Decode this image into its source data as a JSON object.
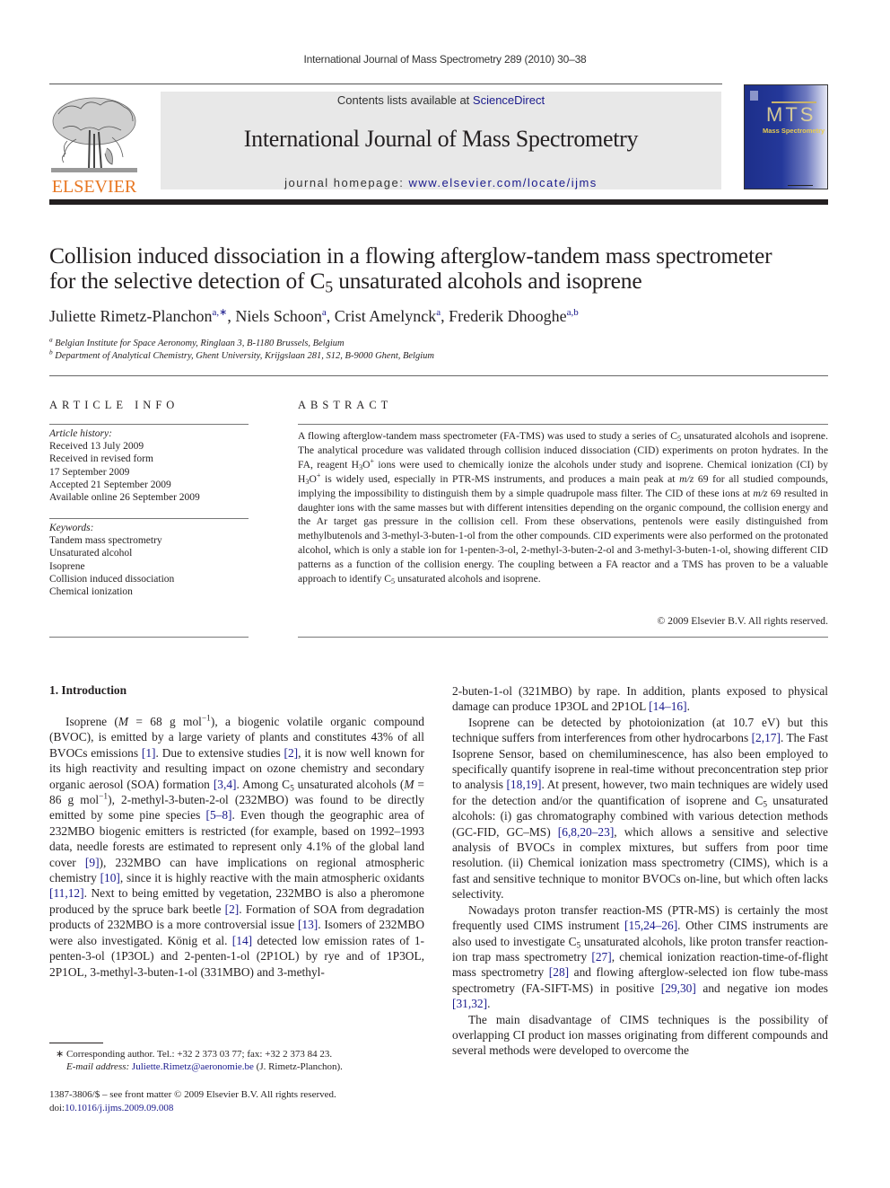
{
  "header": {
    "running_head": "International Journal of Mass Spectrometry 289 (2010) 30–38",
    "contents_prefix": "Contents lists available at ",
    "contents_link": "ScienceDirect",
    "journal_title": "International Journal of Mass Spectrometry",
    "homepage_prefix": "journal homepage: ",
    "homepage_link": "www.elsevier.com/locate/ijms",
    "publisher_logo_text": "ELSEVIER",
    "cover_label": "Mass Spectrometry",
    "cover_monogram": "MTS"
  },
  "colors": {
    "link": "#1a1a8c",
    "elsevier_orange": "#e87722",
    "cover_blue": "#1d2f8a",
    "masthead_gray": "#e8e8e8"
  },
  "article": {
    "title_line1": "Collision induced dissociation in a flowing afterglow-tandem mass spectrometer",
    "title_line2_a": "for the selective detection of C",
    "title_line2_sub": "5",
    "title_line2_b": " unsaturated alcohols and isoprene",
    "authors": [
      {
        "name": "Juliette Rimetz-Planchon",
        "aff": "a,∗"
      },
      {
        "name": "Niels Schoon",
        "aff": "a"
      },
      {
        "name": "Crist Amelynck",
        "aff": "a"
      },
      {
        "name": "Frederik Dhooghe",
        "aff": "a,b"
      }
    ],
    "affiliations": [
      {
        "mark": "a",
        "text": "Belgian Institute for Space Aeronomy, Ringlaan 3, B-1180 Brussels, Belgium"
      },
      {
        "mark": "b",
        "text": "Department of Analytical Chemistry, Ghent University, Krijgslaan 281, S12, B-9000 Ghent, Belgium"
      }
    ]
  },
  "article_info": {
    "heading": "ARTICLE INFO",
    "history_label": "Article history:",
    "history": [
      "Received 13 July 2009",
      "Received in revised form",
      "17 September 2009",
      "Accepted 21 September 2009",
      "Available online 26 September 2009"
    ],
    "keywords_label": "Keywords:",
    "keywords": [
      "Tandem mass spectrometry",
      "Unsaturated alcohol",
      "Isoprene",
      "Collision induced dissociation",
      "Chemical ionization"
    ]
  },
  "abstract": {
    "heading": "ABSTRACT",
    "text": [
      "A flowing afterglow-tandem mass spectrometer (FA-TMS) was used to study a series of C",
      "5",
      " unsaturated alcohols and isoprene. The analytical procedure was validated through collision induced dissociation (CID) experiments on proton hydrates. In the FA, reagent H",
      "3",
      "O",
      "+",
      " ions were used to chemically ionize the alcohols under study and isoprene. Chemical ionization (CI) by H",
      "3",
      "O",
      "+",
      " is widely used, especially in PTR-MS instruments, and produces a main peak at ",
      "m/z",
      " 69 for all studied compounds, implying the impossibility to distinguish them by a simple quadrupole mass filter. The CID of these ions at ",
      "m/z",
      " 69 resulted in daughter ions with the same masses but with different intensities depending on the organic compound, the collision energy and the Ar target gas pressure in the collision cell. From these observations, pentenols were easily distinguished from methylbutenols and 3-methyl-3-buten-1-ol from the other compounds. CID experiments were also performed on the protonated alcohol, which is only a stable ion for 1-penten-3-ol, 2-methyl-3-buten-2-ol and 3-methyl-3-buten-1-ol, showing different CID patterns as a function of the collision energy. The coupling between a FA reactor and a TMS has proven to be a valuable approach to identify C",
      "5",
      " unsaturated alcohols and isoprene."
    ],
    "copyright": "© 2009 Elsevier B.V. All rights reserved."
  },
  "body": {
    "section_heading": "1.  Introduction",
    "left_paragraph": [
      {
        "t": "Isoprene ("
      },
      {
        "i": "M"
      },
      {
        "t": " = 68 g mol"
      },
      {
        "sup": "−1"
      },
      {
        "t": "), a biogenic volatile organic compound (BVOC), is emitted by a large variety of plants and constitutes 43% of all BVOCs emissions "
      },
      {
        "c": "[1]"
      },
      {
        "t": ". Due to extensive studies "
      },
      {
        "c": "[2]"
      },
      {
        "t": ", it is now well known for its high reactivity and resulting impact on ozone chemistry and secondary organic aerosol (SOA) formation "
      },
      {
        "c": "[3,4]"
      },
      {
        "t": ". Among C"
      },
      {
        "sub": "5"
      },
      {
        "t": " unsaturated alcohols ("
      },
      {
        "i": "M"
      },
      {
        "t": " = 86 g mol"
      },
      {
        "sup": "−1"
      },
      {
        "t": "), 2-methyl-3-buten-2-ol (232MBO) was found to be directly emitted by some pine species "
      },
      {
        "c": "[5–8]"
      },
      {
        "t": ". Even though the geographic area of 232MBO biogenic emitters is restricted (for example, based on 1992–1993 data, needle forests are estimated to represent only 4.1% of the global land cover "
      },
      {
        "c": "[9]"
      },
      {
        "t": "), 232MBO can have implications on regional atmospheric chemistry "
      },
      {
        "c": "[10]"
      },
      {
        "t": ", since it is highly reactive with the main atmospheric oxidants "
      },
      {
        "c": "[11,12]"
      },
      {
        "t": ". Next to being emitted by vegetation, 232MBO is also a pheromone produced by the spruce bark beetle "
      },
      {
        "c": "[2]"
      },
      {
        "t": ". Formation of SOA from degradation products of 232MBO is a more controversial issue "
      },
      {
        "c": "[13]"
      },
      {
        "t": ". Isomers of 232MBO were also investigated. König et al. "
      },
      {
        "c": "[14]"
      },
      {
        "t": " detected low emission rates of 1-penten-3-ol (1P3OL) and 2-penten-1-ol (2P1OL) by rye and of 1P3OL, 2P1OL, 3-methyl-3-buten-1-ol (331MBO) and 3-methyl-"
      }
    ],
    "right_paragraphs": [
      {
        "indent": false,
        "parts": [
          {
            "t": "2-buten-1-ol (321MBO) by rape. In addition, plants exposed to physical damage can produce 1P3OL and 2P1OL "
          },
          {
            "c": "[14–16]"
          },
          {
            "t": "."
          }
        ]
      },
      {
        "indent": true,
        "parts": [
          {
            "t": "Isoprene can be detected by photoionization (at 10.7 eV) but this technique suffers from interferences from other hydrocarbons "
          },
          {
            "c": "[2,17]"
          },
          {
            "t": ". The Fast Isoprene Sensor, based on chemiluminescence, has also been employed to specifically quantify isoprene in real-time without preconcentration step prior to analysis "
          },
          {
            "c": "[18,19]"
          },
          {
            "t": ". At present, however, two main techniques are widely used for the detection and/or the quantification of isoprene and C"
          },
          {
            "sub": "5"
          },
          {
            "t": " unsaturated alcohols: (i) gas chromatography combined with various detection methods (GC-FID, GC–MS) "
          },
          {
            "c": "[6,8,20–23]"
          },
          {
            "t": ", which allows a sensitive and selective analysis of BVOCs in complex mixtures, but suffers from poor time resolution. (ii) Chemical ionization mass spectrometry (CIMS), which is a fast and sensitive technique to monitor BVOCs on-line, but which often lacks selectivity."
          }
        ]
      },
      {
        "indent": true,
        "parts": [
          {
            "t": "Nowadays proton transfer reaction-MS (PTR-MS) is certainly the most frequently used CIMS instrument "
          },
          {
            "c": "[15,24–26]"
          },
          {
            "t": ". Other CIMS instruments are also used to investigate C"
          },
          {
            "sub": "5"
          },
          {
            "t": " unsaturated alcohols, like proton transfer reaction-ion trap mass spectrometry "
          },
          {
            "c": "[27]"
          },
          {
            "t": ", chemical ionization reaction-time-of-flight mass spectrometry "
          },
          {
            "c": "[28]"
          },
          {
            "t": " and flowing afterglow-selected ion flow tube-mass spectrometry (FA-SIFT-MS) in positive "
          },
          {
            "c": "[29,30]"
          },
          {
            "t": " and negative ion modes "
          },
          {
            "c": "[31,32]"
          },
          {
            "t": "."
          }
        ]
      },
      {
        "indent": true,
        "parts": [
          {
            "t": "The main disadvantage of CIMS techniques is the possibility of overlapping CI product ion masses originating from different compounds and several methods were developed to overcome the"
          }
        ]
      }
    ]
  },
  "footnotes": {
    "corresponding": "∗  Corresponding author. Tel.: +32 2 373 03 77; fax: +32 2 373 84 23.",
    "email_label": "E-mail address: ",
    "email": "Juliette.Rimetz@aeronomie.be",
    "email_suffix": " (J. Rimetz-Planchon).",
    "front_matter": "1387-3806/$ – see front matter © 2009 Elsevier B.V. All rights reserved.",
    "doi_label": "doi:",
    "doi": "10.1016/j.ijms.2009.09.008"
  }
}
